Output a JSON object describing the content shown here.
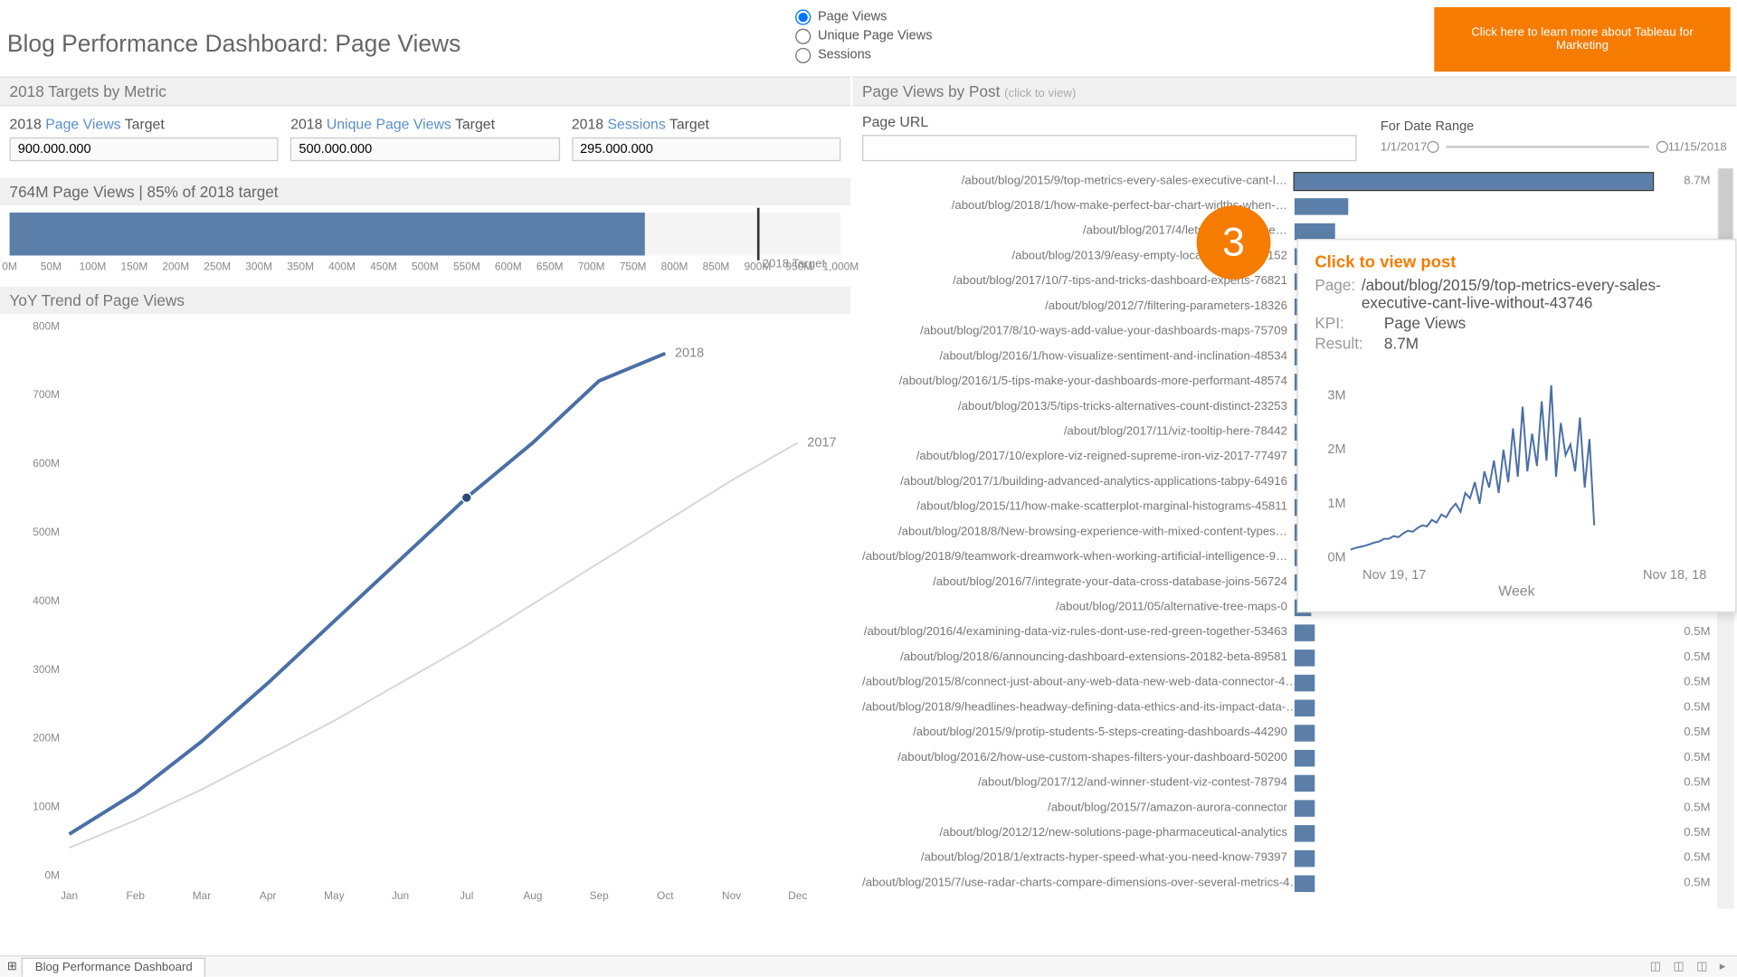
{
  "header": {
    "title": "Blog Performance Dashboard: Page Views",
    "cta": "Click here to learn more about Tableau for Marketing"
  },
  "metric_radio": {
    "options": [
      "Page Views",
      "Unique Page Views",
      "Sessions"
    ],
    "selected": 0
  },
  "targets_section": {
    "title": "2018 Targets by Metric"
  },
  "targets": [
    {
      "year": "2018",
      "metric": "Page Views",
      "suffix": "Target",
      "value": "900.000.000"
    },
    {
      "year": "2018",
      "metric": "Unique Page Views",
      "suffix": "Target",
      "value": "500.000.000"
    },
    {
      "year": "2018",
      "metric": "Sessions",
      "suffix": "Target",
      "value": "295.000.000"
    }
  ],
  "progress": {
    "summary": "764M Page Views  |  85% of 2018 target",
    "target_label": "2018 Target",
    "ticks": [
      "0M",
      "50M",
      "100M",
      "150M",
      "200M",
      "250M",
      "300M",
      "350M",
      "400M",
      "450M",
      "500M",
      "550M",
      "600M",
      "650M",
      "700M",
      "750M",
      "800M",
      "850M",
      "900M",
      "950M",
      "1,000M"
    ]
  },
  "trend_section": {
    "title": "YoY Trend of Page Views"
  },
  "posts_section": {
    "title": "Page Views by Post",
    "subtitle": "(click to view)"
  },
  "url": {
    "label": "Page URL",
    "value": ""
  },
  "date_range": {
    "label": "For Date Range",
    "start": "1/1/2017",
    "end": "11/15/2018"
  },
  "footer": {
    "tab": "Blog Performance Dashboard"
  },
  "tooltip": {
    "title": "Click to view post",
    "page_k": "Page:",
    "page_v": "/about/blog/2015/9/top-metrics-every-sales-executive-cant-live-without-43746",
    "kpi_k": "KPI:",
    "kpi_v": "Page Views",
    "res_k": "Result:",
    "res_v": "8.7M",
    "x_start": "Nov 19, 17",
    "x_end": "Nov 18, 18",
    "x_label": "Week",
    "y_ticks": [
      "0M",
      "1M",
      "2M",
      "3M"
    ]
  },
  "callout": "3",
  "chart_data": [
    {
      "id": "bullet",
      "type": "bar",
      "title": "764M Page Views | 85% of 2018 target",
      "values": [
        764
      ],
      "target": 900,
      "xlim": [
        0,
        1000
      ],
      "x_ticks": [
        0,
        50,
        100,
        150,
        200,
        250,
        300,
        350,
        400,
        450,
        500,
        550,
        600,
        650,
        700,
        750,
        800,
        850,
        900,
        950,
        1000
      ],
      "x_unit": "M"
    },
    {
      "id": "yoy_trend",
      "type": "line",
      "title": "YoY Trend of Page Views",
      "categories": [
        "Jan",
        "Feb",
        "Mar",
        "Apr",
        "May",
        "Jun",
        "Jul",
        "Aug",
        "Sep",
        "Oct",
        "Nov",
        "Dec"
      ],
      "series": [
        {
          "name": "2018",
          "values": [
            60,
            120,
            195,
            280,
            370,
            460,
            550,
            630,
            720,
            760,
            null,
            null
          ]
        },
        {
          "name": "2017",
          "values": [
            40,
            80,
            125,
            175,
            225,
            280,
            335,
            395,
            455,
            515,
            575,
            630
          ]
        }
      ],
      "ylabel": "",
      "ylim": [
        0,
        800
      ],
      "y_unit": "M",
      "y_ticks": [
        0,
        100,
        200,
        300,
        400,
        500,
        600,
        700,
        800
      ],
      "highlight_point": {
        "series": "2018",
        "category": "Jul"
      }
    },
    {
      "id": "posts_bar",
      "type": "bar",
      "title": "Page Views by Post",
      "orientation": "horizontal",
      "xlabel": "",
      "xlim": [
        0,
        9
      ],
      "x_unit": "M",
      "categories": [
        "/about/blog/2015/9/top-metrics-every-sales-executive-cant-l…",
        "/about/blog/2018/1/how-make-perfect-bar-chart-widths-when-…",
        "/about/blog/2017/4/lets-talk-advance…",
        "/about/blog/2013/9/easy-empty-local-extracts-25152",
        "/about/blog/2017/10/7-tips-and-tricks-dashboard-experts-76821",
        "/about/blog/2012/7/filtering-parameters-18326",
        "/about/blog/2017/8/10-ways-add-value-your-dashboards-maps-75709",
        "/about/blog/2016/1/how-visualize-sentiment-and-inclination-48534",
        "/about/blog/2016/1/5-tips-make-your-dashboards-more-performant-48574",
        "/about/blog/2013/5/tips-tricks-alternatives-count-distinct-23253",
        "/about/blog/2017/11/viz-tooltip-here-78442",
        "/about/blog/2017/10/explore-viz-reigned-supreme-iron-viz-2017-77497",
        "/about/blog/2017/1/building-advanced-analytics-applications-tabpy-64916",
        "/about/blog/2015/11/how-make-scatterplot-marginal-histograms-45811",
        "/about/blog/2018/8/New-browsing-experience-with-mixed-content-types…",
        "/about/blog/2018/9/teamwork-dreamwork-when-working-artificial-intelligence-9…",
        "/about/blog/2016/7/integrate-your-data-cross-database-joins-56724",
        "/about/blog/2011/05/alternative-tree-maps-0",
        "/about/blog/2016/4/examining-data-viz-rules-dont-use-red-green-together-53463",
        "/about/blog/2018/6/announcing-dashboard-extensions-20182-beta-89581",
        "/about/blog/2015/8/connect-just-about-any-web-data-new-web-data-connector-4…",
        "/about/blog/2018/9/headlines-headway-defining-data-ethics-and-its-impact-data-…",
        "/about/blog/2015/9/protip-students-5-steps-creating-dashboards-44290",
        "/about/blog/2016/2/how-use-custom-shapes-filters-your-dashboard-50200",
        "/about/blog/2017/12/and-winner-student-viz-contest-78794",
        "/about/blog/2015/7/amazon-aurora-connector",
        "/about/blog/2012/12/new-solutions-page-pharmaceutical-analytics",
        "/about/blog/2018/1/extracts-hyper-speed-what-you-need-know-79397",
        "/about/blog/2015/7/use-radar-charts-compare-dimensions-over-several-metrics-4…"
      ],
      "values": [
        8.7,
        1.3,
        1.0,
        0.8,
        0.7,
        0.65,
        0.6,
        0.58,
        0.55,
        0.53,
        0.5,
        0.5,
        0.48,
        0.46,
        0.45,
        0.43,
        0.42,
        0.4,
        0.5,
        0.5,
        0.5,
        0.5,
        0.5,
        0.5,
        0.5,
        0.5,
        0.5,
        0.5,
        0.5
      ],
      "value_labels": [
        "8.7M",
        "",
        "",
        "",
        "",
        "",
        "",
        "",
        "",
        "",
        "",
        "",
        "",
        "",
        "",
        "",
        "",
        "",
        "0.5M",
        "0.5M",
        "0.5M",
        "0.5M",
        "0.5M",
        "0.5M",
        "0.5M",
        "0.5M",
        "0.5M",
        "0.5M",
        "0.5M"
      ]
    },
    {
      "id": "tooltip_spark",
      "type": "line",
      "title": "",
      "xlabel": "Week",
      "xdomain": [
        "Nov 19, 17",
        "Nov 18, 18"
      ],
      "ylim": [
        0,
        3.5
      ],
      "y_unit": "M",
      "y_ticks": [
        0,
        1,
        2,
        3
      ],
      "values": [
        0.15,
        0.18,
        0.2,
        0.22,
        0.25,
        0.28,
        0.3,
        0.35,
        0.35,
        0.4,
        0.38,
        0.45,
        0.5,
        0.48,
        0.55,
        0.6,
        0.58,
        0.7,
        0.65,
        0.8,
        0.75,
        0.9,
        1.0,
        0.85,
        1.2,
        1.1,
        1.4,
        1.0,
        1.6,
        1.3,
        1.8,
        1.2,
        2.0,
        1.4,
        2.4,
        1.5,
        2.8,
        1.6,
        2.3,
        1.7,
        2.9,
        1.8,
        3.2,
        1.5,
        2.5,
        1.9,
        2.1,
        1.6,
        2.6,
        1.3,
        2.2,
        0.6
      ]
    }
  ]
}
